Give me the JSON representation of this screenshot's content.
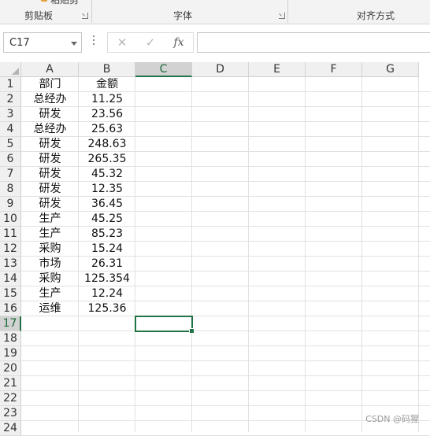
{
  "ribbon": {
    "top_fragment": "粘贴剪",
    "groups": [
      {
        "label": "剪贴板"
      },
      {
        "label": "字体"
      },
      {
        "label": "对齐方式"
      }
    ]
  },
  "formula_bar": {
    "name_box": "C17",
    "cancel_icon": "✕",
    "enter_icon": "✓",
    "fx_label": "fx",
    "formula_value": ""
  },
  "grid": {
    "columns": [
      "A",
      "B",
      "C",
      "D",
      "E",
      "F",
      "G"
    ],
    "selected_column": "C",
    "row_numbers": [
      "1",
      "2",
      "3",
      "4",
      "5",
      "6",
      "7",
      "8",
      "9",
      "10",
      "11",
      "12",
      "13",
      "14",
      "15",
      "16",
      "17",
      "18",
      "19",
      "20",
      "21",
      "22",
      "23",
      "24"
    ],
    "selected_row": "17",
    "active_cell": "C17",
    "rows": [
      {
        "a": "部门",
        "b": "金额"
      },
      {
        "a": "总经办",
        "b": "11.25"
      },
      {
        "a": "研发",
        "b": "23.56"
      },
      {
        "a": "总经办",
        "b": "25.63"
      },
      {
        "a": "研发",
        "b": "248.63"
      },
      {
        "a": "研发",
        "b": "265.35"
      },
      {
        "a": "研发",
        "b": "45.32"
      },
      {
        "a": "研发",
        "b": "12.35"
      },
      {
        "a": "研发",
        "b": "36.45"
      },
      {
        "a": "生产",
        "b": "45.25"
      },
      {
        "a": "生产",
        "b": "85.23"
      },
      {
        "a": "采购",
        "b": "15.24"
      },
      {
        "a": "市场",
        "b": "26.31"
      },
      {
        "a": "采购",
        "b": "125.354"
      },
      {
        "a": "生产",
        "b": "12.24"
      },
      {
        "a": "运维",
        "b": "125.36"
      }
    ]
  },
  "watermark": "CSDN @码猩",
  "colors": {
    "accent": "#217346",
    "header_bg": "#f0f0f0",
    "selected_header_bg": "#d2d2d2",
    "gridline": "#e1e1e1"
  }
}
